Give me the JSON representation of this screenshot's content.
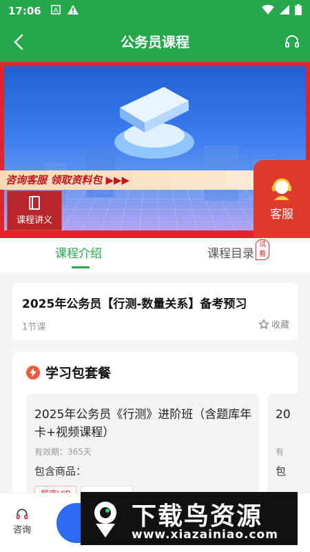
{
  "status_bar": {
    "time": "17:06"
  },
  "app_bar": {
    "title": "公务员课程"
  },
  "banner": {
    "promo_text": "咨询客服  领取资料包 ▶▶▶",
    "lecture_label": "课程讲义",
    "service_label": "客服"
  },
  "tabs": [
    {
      "label": "课程介绍"
    },
    {
      "label": "课程目录",
      "badge": "试看"
    }
  ],
  "course": {
    "title": "2025年公务员【行测-数量关系】备考预习",
    "lessons": "1节课",
    "favorite_label": "收藏"
  },
  "package_section": {
    "heading": "学习包套餐",
    "items": [
      {
        "name": "2025年公务员《行测》进阶班（含题库年卡+视频课程）",
        "validity": "有效期：365天",
        "includes_label": "包含商品：",
        "tags": [
          "题库VIP",
          ""
        ]
      },
      {
        "name": "20",
        "validity": "有",
        "includes_label": "包"
      }
    ]
  },
  "bottom_bar": {
    "consult_label": "咨询"
  },
  "watermark": {
    "title": "下载鸟资源",
    "url": "www.xiazainiao.com"
  }
}
